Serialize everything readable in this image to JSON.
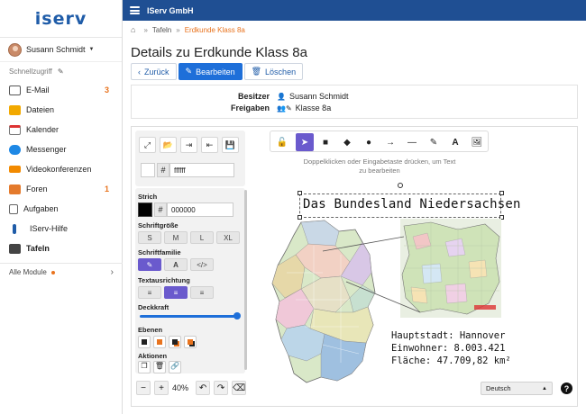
{
  "logo": "iserv",
  "user": {
    "name": "Susann Schmidt"
  },
  "quick_access": "Schnellzugriff",
  "nav": [
    {
      "label": "E-Mail",
      "badge": "3",
      "icon": "mail-icon"
    },
    {
      "label": "Dateien",
      "badge": "",
      "icon": "folder-icon"
    },
    {
      "label": "Kalender",
      "badge": "",
      "icon": "calendar-icon"
    },
    {
      "label": "Messenger",
      "badge": "",
      "icon": "chat-icon"
    },
    {
      "label": "Videokonferenzen",
      "badge": "",
      "icon": "video-icon"
    },
    {
      "label": "Foren",
      "badge": "1",
      "icon": "forum-icon"
    },
    {
      "label": "Aufgaben",
      "badge": "",
      "icon": "tasks-icon"
    },
    {
      "label": "IServ-Hilfe",
      "badge": "",
      "icon": "help-icon"
    },
    {
      "label": "Tafeln",
      "badge": "",
      "icon": "board-icon"
    }
  ],
  "all_modules": "Alle Module",
  "topbar": {
    "title": "IServ GmbH"
  },
  "breadcrumb": {
    "parent": "Tafeln",
    "current": "Erdkunde Klass 8a"
  },
  "page_title": "Details zu Erdkunde Klass 8a",
  "buttons": {
    "back": "Zurück",
    "edit": "Bearbeiten",
    "delete": "Löschen"
  },
  "info": {
    "owner_label": "Besitzer",
    "owner_value": "Susann Schmidt",
    "share_label": "Freigaben",
    "share_value": "Klasse 8a"
  },
  "fill_hex": "ffffff",
  "stroke": {
    "label": "Strich",
    "hex": "000000"
  },
  "font_size": {
    "label": "Schriftgröße",
    "options": [
      "S",
      "M",
      "L",
      "XL"
    ]
  },
  "font_family_label": "Schriftfamilie",
  "text_align_label": "Textausrichtung",
  "opacity": {
    "label": "Deckkraft",
    "value": 1.0
  },
  "layers_label": "Ebenen",
  "actions_label": "Aktionen",
  "hint": "Doppelklicken oder Eingabetaste drücken, um Text zu bearbeiten",
  "canvas": {
    "heading": "Das Bundesland Niedersachsen",
    "facts": [
      "Hauptstadt: Hannover",
      "Einwohner: 8.003.421",
      "Fläche: 47.709,82 km²"
    ]
  },
  "zoom": "40%",
  "language": "Deutsch",
  "colors": {
    "topbar": "#1f4f93",
    "primary": "#1e6fd9",
    "accent": "#e8731e",
    "tool_selected": "#6a5acd"
  }
}
